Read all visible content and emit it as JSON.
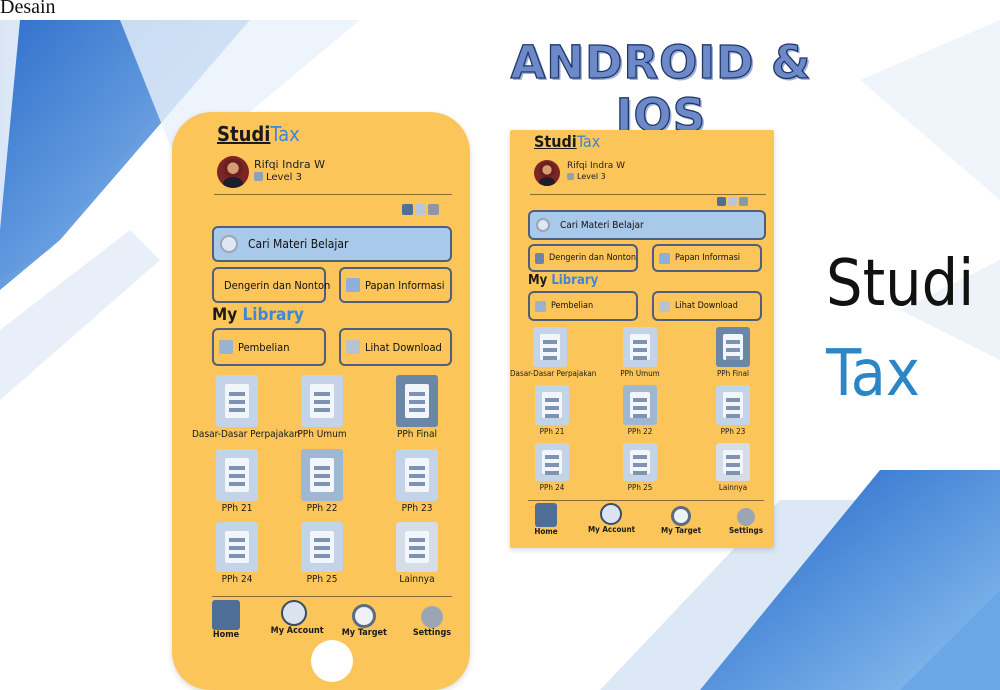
{
  "doc_label": "Desain",
  "headline": "ANDROID & IOS",
  "brand_big": {
    "line1": "Studi",
    "line2": "Tax"
  },
  "app": {
    "brand_studi": "Studi",
    "brand_tax": "Tax",
    "user_name": "Rifqi Indra W",
    "user_level": "Level 3",
    "search_placeholder": "Cari Materi Belajar",
    "quick_actions": [
      "Dengerin dan Nonton",
      "Papan Informasi"
    ],
    "library_my": "My",
    "library_word": "Library",
    "library_actions": [
      "Pembelian",
      "Lihat Download"
    ],
    "tiles": [
      "Dasar-Dasar Perpajakan",
      "PPh Umum",
      "PPh Final",
      "PPh 21",
      "PPh 22",
      "PPh 23",
      "PPh 24",
      "PPh 25",
      "Lainnya"
    ],
    "nav": [
      "Home",
      "My Account",
      "My Target",
      "Settings"
    ]
  },
  "colors": {
    "phone": "#fbc55a",
    "accent": "#3d86d8",
    "search": "#a8c9ea",
    "headline": "#6d89c8"
  }
}
